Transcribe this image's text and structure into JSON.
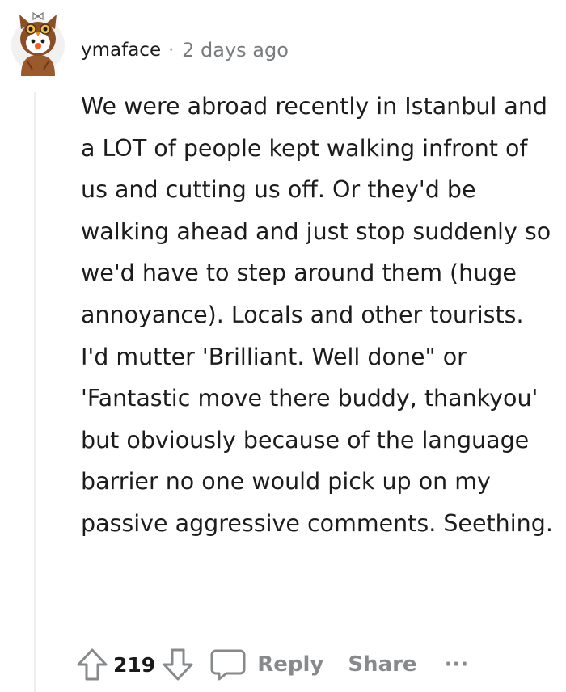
{
  "comment": {
    "author": "ymaface",
    "separator": "·",
    "timestamp": "2 days ago",
    "body": "We were abroad recently in Istanbul and a LOT of people kept walking infront of us and cutting us off. Or they'd be walking ahead and just stop suddenly so we'd have to step around them (huge annoyance). Locals and other tourists. I'd mutter 'Brilliant. Well done\" or 'Fantastic move there buddy, thankyou' but obviously because of the language barrier no one would pick up on my passive aggressive comments. Seething.",
    "score": "219"
  },
  "actions": {
    "reply_label": "Reply",
    "share_label": "Share",
    "more_label": "···"
  },
  "icons": {
    "upvote": "arrow-up-outline-icon",
    "downvote": "arrow-down-outline-icon",
    "reply": "speech-bubble-icon",
    "avatar": "owl-costume-avatar"
  },
  "colors": {
    "text": "#1c1c1c",
    "meta": "#787c7e",
    "icon": "#878a8c",
    "thread_line": "#edeff1"
  }
}
